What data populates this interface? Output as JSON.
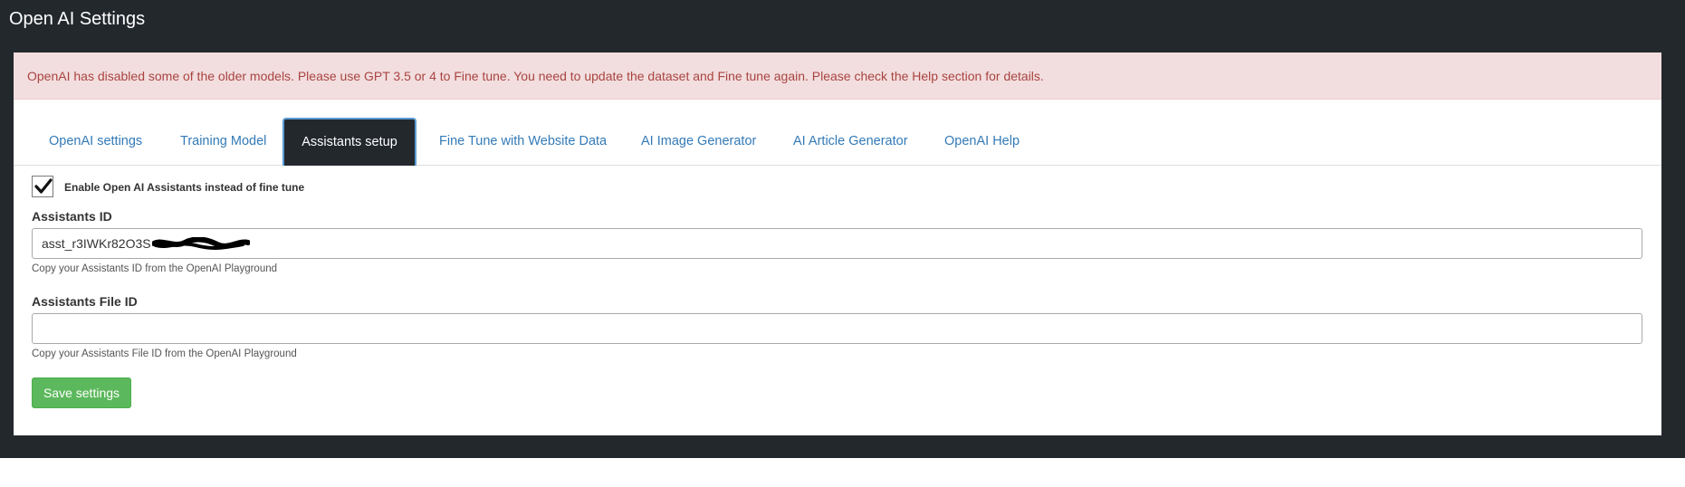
{
  "header": {
    "title": "Open AI Settings"
  },
  "alert": {
    "message": "OpenAI has disabled some of the older models. Please use GPT 3.5 or 4 to Fine tune. You need to update the dataset and Fine tune again. Please check the Help section for details."
  },
  "tabs": [
    {
      "label": "OpenAI settings",
      "active": false
    },
    {
      "label": "Training Model",
      "active": false
    },
    {
      "label": "Assistants setup",
      "active": true
    },
    {
      "label": "Fine Tune with Website Data",
      "active": false
    },
    {
      "label": "AI Image Generator",
      "active": false
    },
    {
      "label": "AI Article Generator",
      "active": false
    },
    {
      "label": "OpenAI Help",
      "active": false
    }
  ],
  "form": {
    "enable_assistants": {
      "label": "Enable Open AI Assistants instead of fine tune",
      "checked": true
    },
    "assistants_id": {
      "label": "Assistants ID",
      "value": "asst_r3IWKr82O3S",
      "help": "Copy your Assistants ID from the OpenAI Playground"
    },
    "assistants_file_id": {
      "label": "Assistants File ID",
      "value": "",
      "help": "Copy your Assistants File ID from the OpenAI Playground"
    },
    "save_label": "Save settings"
  },
  "colors": {
    "header_bg": "#23282d",
    "alert_bg": "#f2dede",
    "alert_text": "#a94442",
    "link": "#337ab7",
    "save_button": "#5cb85c"
  }
}
